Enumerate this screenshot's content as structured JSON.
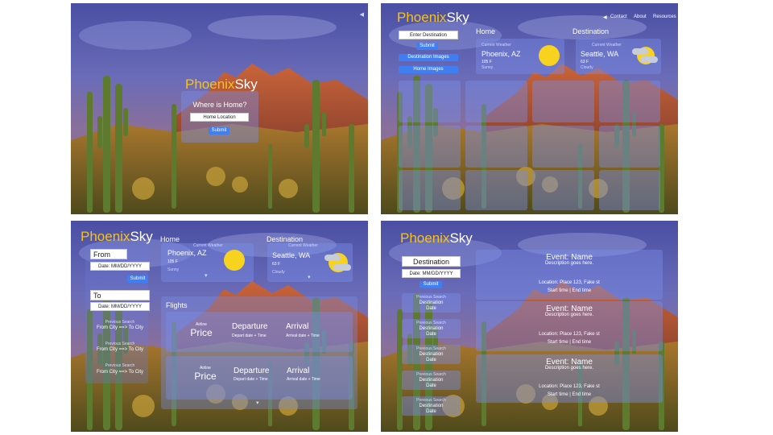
{
  "brand": {
    "part1": "Phoenix",
    "part2": "Sky"
  },
  "colors": {
    "accent": "#f4c21b",
    "button": "#3f7ff2",
    "glass": "#7a8ce6"
  },
  "landing": {
    "collapse_icon": "chevron-left-icon",
    "question": "Where is Home?",
    "home_input": "Home Location",
    "submit": "Submit"
  },
  "dashboard": {
    "nav": [
      "Contact",
      "About",
      "Resources"
    ],
    "nav_icon": "chevron-left-icon",
    "dest_input": "Enter Destination",
    "submit": "Submit",
    "dest_images": "Destination Images",
    "home_images": "Home Images",
    "home_heading": "Home",
    "dest_heading": "Destination",
    "home_weather": {
      "caption": "Current Weather",
      "city": "Phoenix, AZ",
      "temp": "105 F",
      "cond": "Sunny",
      "icon": "sun-icon"
    },
    "dest_weather": {
      "caption": "Current Weather",
      "city": "Seattle, WA",
      "temp": "63 F",
      "cond": "Cloudy",
      "icon": "partly-cloudy-icon"
    }
  },
  "flights": {
    "from_label": "From",
    "from_date": "Date: MM/DD/YYYY",
    "submit": "Submit",
    "to_label": "To",
    "to_date": "Date: MM/DD/YYYY",
    "history_caption": "Previous Search",
    "history": [
      "From City ==> To City",
      "From City ==> To City",
      "From City ==> To City"
    ],
    "home_heading": "Home",
    "dest_heading": "Destination",
    "home_weather": {
      "caption": "Current Weather",
      "city": "Phoenix, AZ",
      "temp": "105 F",
      "cond": "Sunny"
    },
    "dest_weather": {
      "caption": "Current Weather",
      "city": "Seattle, WA",
      "temp": "63 F",
      "cond": "Cloudy"
    },
    "flights_heading": "Flights",
    "rows": [
      {
        "airline": "Airline",
        "price": "Price",
        "departure": "Departure",
        "depart_detail": "Depart date + Time",
        "arrival": "Arrival",
        "arrival_detail": "Arrival date + Time"
      },
      {
        "airline": "Airline",
        "price": "Price",
        "departure": "Departure",
        "depart_detail": "Depart date + Time",
        "arrival": "Arrival",
        "arrival_detail": "Arrival date + Time"
      }
    ]
  },
  "events": {
    "dest_label": "Destination",
    "date_input": "Date: MM/DD/YYYY",
    "submit": "Submit",
    "history_caption": "Previous Search",
    "history": [
      {
        "dest": "Destination",
        "date": "Date"
      },
      {
        "dest": "Destination",
        "date": "Date"
      },
      {
        "dest": "Destination",
        "date": "Date"
      },
      {
        "dest": "Destination",
        "date": "Date"
      },
      {
        "dest": "Destination",
        "date": "Date"
      }
    ],
    "list": [
      {
        "title": "Event: Name",
        "desc": "Description goes here.",
        "location": "Location: Place 123, Fake st",
        "time": "Start time | End time"
      },
      {
        "title": "Event: Name",
        "desc": "Description goes here.",
        "location": "Location: Place 123, Fake st",
        "time": "Start time | End time"
      },
      {
        "title": "Event: Name",
        "desc": "Description goes here.",
        "location": "Location: Place 123, Fake st",
        "time": "Start time | End time"
      }
    ]
  }
}
